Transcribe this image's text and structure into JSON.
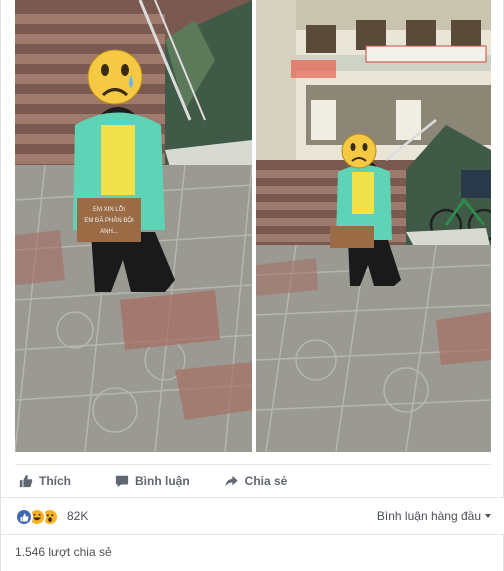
{
  "actions": {
    "like_label": "Thích",
    "comment_label": "Bình luận",
    "share_label": "Chia sẻ",
    "like_icon": "thumbs-up-icon",
    "comment_icon": "speech-bubble-icon",
    "share_icon": "share-arrow-icon"
  },
  "reactions": {
    "types": [
      "like",
      "haha",
      "wow"
    ],
    "count": "82K",
    "sort_label": "Bình luận hàng đầu"
  },
  "shares": {
    "label": "1.546 lượt chia sẻ"
  },
  "photos": {
    "sign_text": "EM XIN LỖI EM ĐÃ PHẢN BỘI ANH...",
    "banner_text": "",
    "colors": {
      "jacket": "#5fd3b5",
      "shirt_yellow": "#f1e24b",
      "emoji": "#f6c945",
      "pavement": "#9a9a93",
      "pavement_red": "#a56d63",
      "wall": "#e9e6d8",
      "accent": "#4267b2"
    }
  }
}
